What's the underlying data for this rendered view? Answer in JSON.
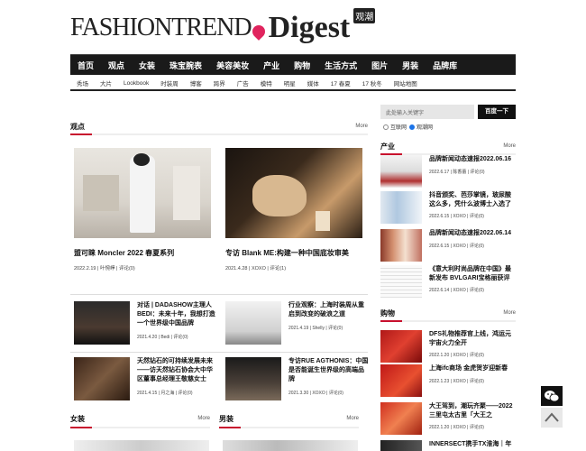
{
  "logo": {
    "part1": "FASHIONTREND",
    "part2": "Digest",
    "part3": "观潮"
  },
  "nav": [
    "首页",
    "观点",
    "女装",
    "珠宝腕表",
    "美容美妆",
    "产业",
    "购物",
    "生活方式",
    "图片",
    "男装",
    "品牌库"
  ],
  "subnav": [
    "秀场",
    "大片",
    "Lookbook",
    "时装周",
    "博客",
    "跨界",
    "广告",
    "模特",
    "明星",
    "媒体",
    "17 春夏",
    "17 秋冬",
    "网站地图"
  ],
  "guandian": {
    "title": "观点",
    "more": "More",
    "big": [
      {
        "title": "盟可睐 Moncler 2022 春夏系列",
        "meta": "2022.2.19 | 叶惋崢 | 评论(0)"
      },
      {
        "title": "专访 Blank ME:构建一种中国底妆审美",
        "meta": "2021.4.28 | XOXO | 评论(1)"
      }
    ],
    "small": [
      {
        "title": "对话 | DADASHOW主理人BEDI：未来十年，我想打造一个世界级中国品牌",
        "meta": "2021.4.20 | Bedi | 评论(0)"
      },
      {
        "title": "行业观察：上海时装周从重启到改变的破浪之道",
        "meta": "2021.4.19 | Shelly | 评论(0)"
      },
      {
        "title": "天然钻石的可持续发展未来——访天然钻石协会大中华区董事总经理王敬慈女士",
        "meta": "2021.4.15 | 月之海 | 评论(0)"
      },
      {
        "title": "专访RUE AGTHONIS：中国是否能诞生世界级的高端品牌",
        "meta": "2021.3.30 | XOXO | 评论(0)"
      }
    ]
  },
  "nvzhuang": {
    "title": "女装",
    "more": "More"
  },
  "nanzhuang": {
    "title": "男装",
    "more": "More"
  },
  "search": {
    "placeholder": "此处输入关键字",
    "button": "百度一下",
    "opt1": "互联网",
    "opt2": "观潮网"
  },
  "chanye": {
    "title": "产业",
    "more": "More",
    "items": [
      {
        "title": "品牌新闻动态速报2022.06.16",
        "meta": "2022.6.17 | 陈香蕾 | 评论(0)"
      },
      {
        "title": "抖音颁奖、芭莎掌镜，玻尿酸这么多，凭什么波博士入选了",
        "meta": "2022.6.15 | XOXO | 评论(0)"
      },
      {
        "title": "品牌新闻动态速报2022.06.14",
        "meta": "2022.6.15 | XOXO | 评论(0)"
      },
      {
        "title": "《意大利时尚品牌在中国》最新发布 BVLGARI宝格丽获评",
        "meta": "2022.6.14 | XOXO | 评论(0)"
      }
    ]
  },
  "gouwu": {
    "title": "购物",
    "more": "More",
    "items": [
      {
        "title": "DFS礼物推荐官上线，鸿运元宇宙火力全开",
        "meta": "2022.1.20 | XOXO | 评论(0)"
      },
      {
        "title": "上海ifc商场 金虎贺岁迎新春",
        "meta": "2022.1.23 | XOXO | 评论(0)"
      },
      {
        "title": "大王驾到，潮玩齐聚——2022三里屯太古里「大王之",
        "meta": "2022.1.20 | XOXO | 评论(0)"
      },
      {
        "title": "INNERSECT携手TX淮海｜年",
        "meta": ""
      }
    ]
  },
  "colors": {
    "accent": "#c8102e",
    "nav": "#1a1a1a"
  }
}
